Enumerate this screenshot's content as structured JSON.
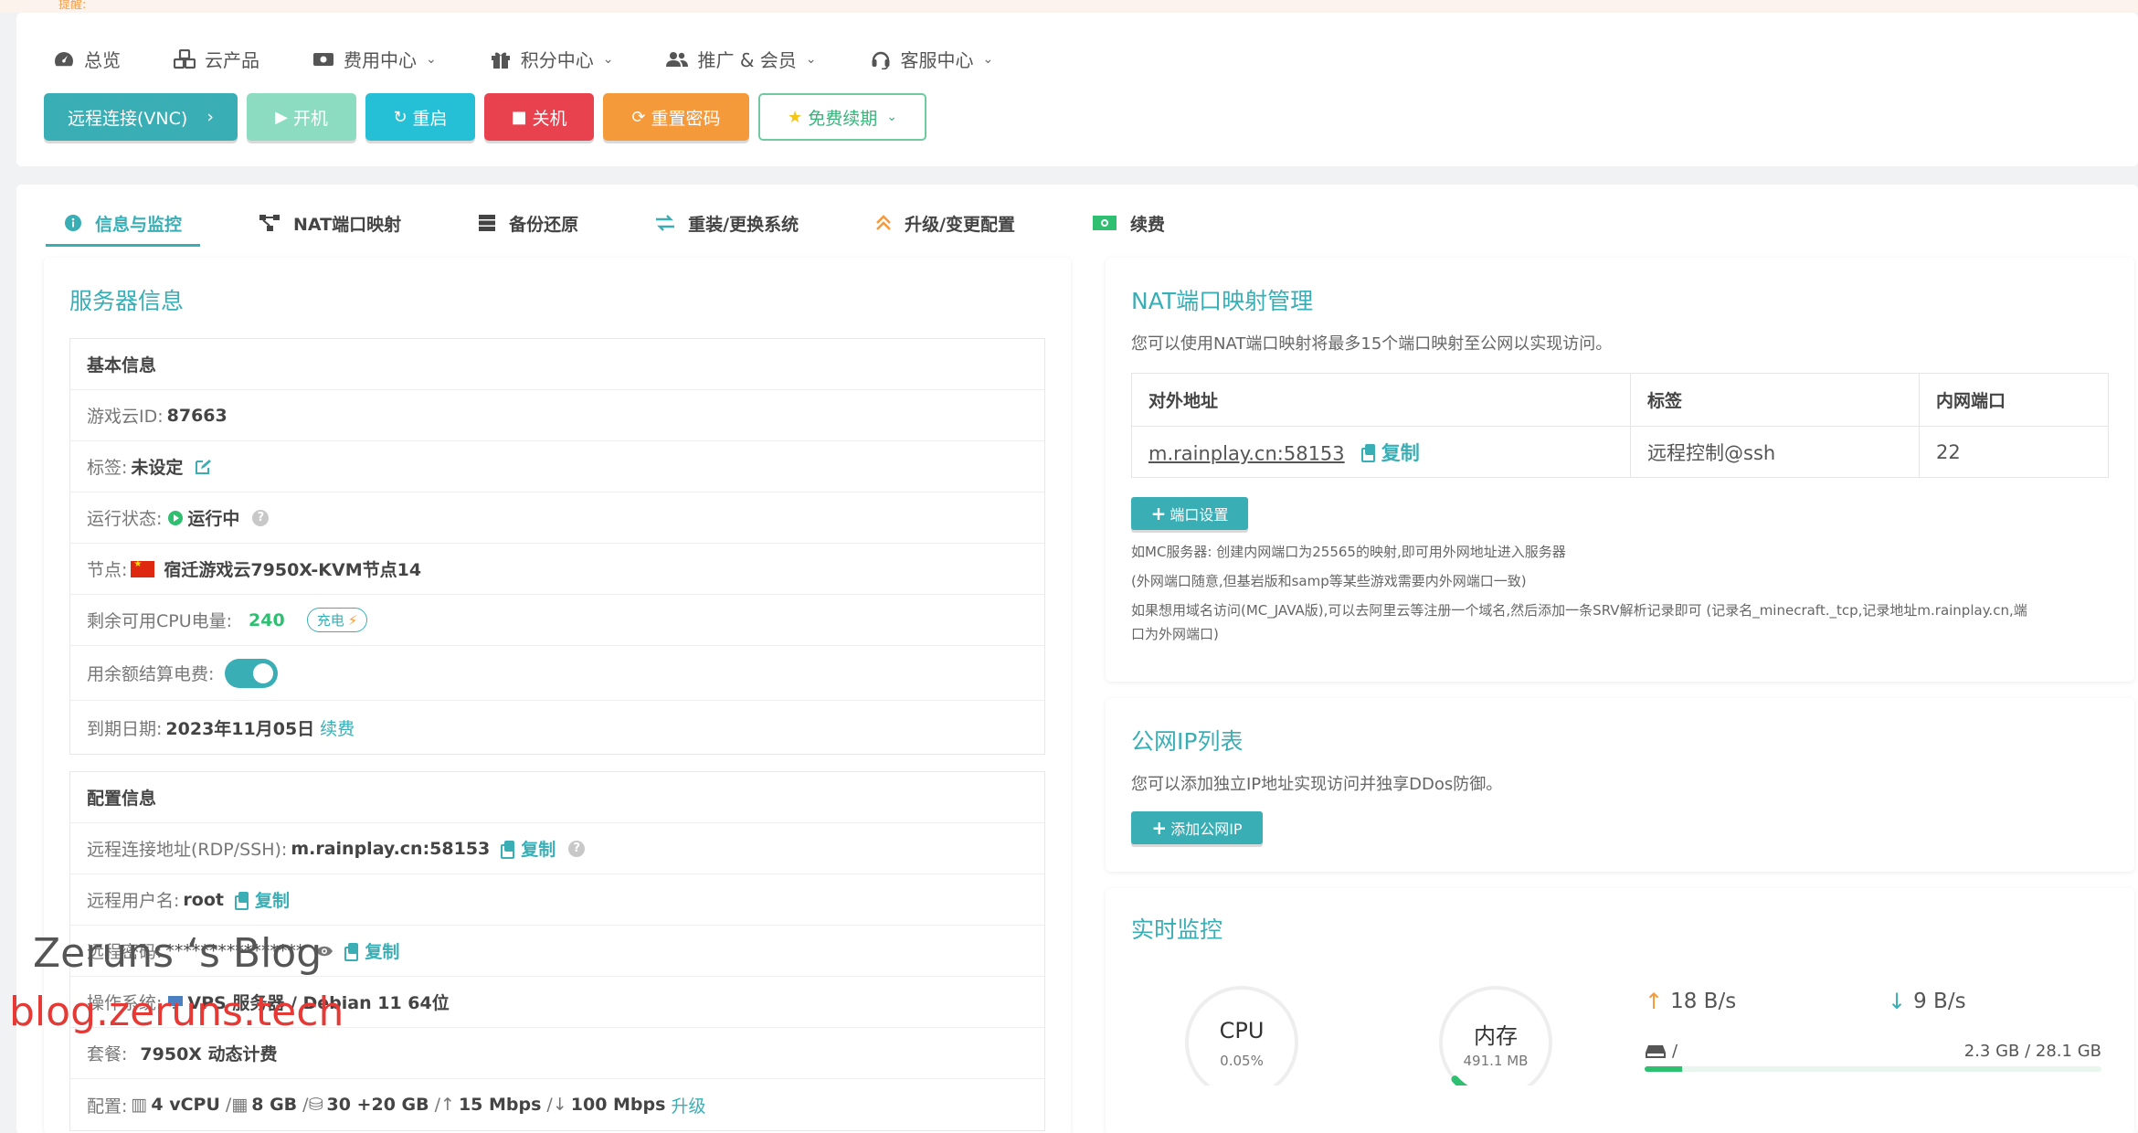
{
  "top_notice": "提醒:",
  "nav": [
    {
      "label": "总览",
      "icon": "dashboard-icon",
      "dropdown": false
    },
    {
      "label": "云产品",
      "icon": "cubes-icon",
      "dropdown": false
    },
    {
      "label": "费用中心",
      "icon": "money-icon",
      "dropdown": true
    },
    {
      "label": "积分中心",
      "icon": "gift-icon",
      "dropdown": true
    },
    {
      "label": "推广 & 会员",
      "icon": "users-icon",
      "dropdown": true
    },
    {
      "label": "客服中心",
      "icon": "headset-icon",
      "dropdown": true
    }
  ],
  "actions": {
    "vnc": "远程连接(VNC)",
    "power_on": "开机",
    "restart": "重启",
    "power_off": "关机",
    "reset_password": "重置密码",
    "free_renew": "免费续期"
  },
  "tabs": [
    {
      "label": "信息与监控",
      "active": true
    },
    {
      "label": "NAT端口映射"
    },
    {
      "label": "备份还原"
    },
    {
      "label": "重装/更换系统"
    },
    {
      "label": "升级/变更配置"
    },
    {
      "label": "续费"
    }
  ],
  "server": {
    "title": "服务器信息",
    "basic": {
      "header": "基本信息",
      "id_label": "游戏云ID:",
      "id_value": "87663",
      "tag_label": "标签:",
      "tag_value": "未设定",
      "status_label": "运行状态:",
      "status_value": "运行中",
      "node_label": "节点:",
      "node_value": "宿迁游戏云7950X-KVM节点14",
      "cpu_power_label": "剩余可用CPU电量:",
      "cpu_power_value": "240",
      "recharge": "充电",
      "balance_label": "用余额结算电费:",
      "balance_enabled": true,
      "expire_label": "到期日期:",
      "expire_value": "2023年11月05日",
      "renew_link": "续费"
    },
    "config": {
      "header": "配置信息",
      "remote_label": "远程连接地址(RDP/SSH):",
      "remote_value": "m.rainplay.cn:58153",
      "user_label": "远程用户名:",
      "user_value": "root",
      "pw_label": "远程密码:",
      "pw_value": "****************",
      "os_label": "操作系统:",
      "os_value": "VPS 服务器 / Debian 11 64位",
      "plan_label": "套餐:",
      "plan_value": "7950X 动态计费",
      "spec_label": "配置:",
      "spec_cpu": "4 vCPU",
      "spec_ram": "8 GB",
      "spec_disk": "30 +20 GB",
      "spec_up": "15 Mbps",
      "spec_down": "100 Mbps",
      "upgrade_link": "升级"
    },
    "copy_label": "复制"
  },
  "nat": {
    "title": "NAT端口映射管理",
    "desc": "您可以使用NAT端口映射将最多15个端口映射至公网以实现访问。",
    "columns": [
      "对外地址",
      "标签",
      "内网端口"
    ],
    "rows": [
      {
        "address": "m.rainplay.cn:58153",
        "tag": "远程控制@ssh",
        "port": "22"
      }
    ],
    "copy_label": "复制",
    "port_settings": "端口设置",
    "notes": [
      "如MC服务器: 创建内网端口为25565的映射,即可用外网地址进入服务器",
      "(外网端口随意,但基岩版和samp等某些游戏需要内外网端口一致)",
      "如果想用域名访问(MC_JAVA版),可以去阿里云等注册一个域名,然后添加一条SRV解析记录即可 (记录名_minecraft._tcp,记录地址m.rainplay.cn,端",
      "口为外网端口)"
    ]
  },
  "public_ip": {
    "title": "公网IP列表",
    "desc": "您可以添加独立IP地址实现访问并独享DDos防御。",
    "add_button": "添加公网IP"
  },
  "monitor": {
    "title": "实时监控",
    "cpu_label": "CPU",
    "cpu_value": "0.05%",
    "cpu_fraction": 0.0005,
    "mem_label": "内存",
    "mem_value": "491.1 MB",
    "mem_fraction": 0.06,
    "upload": "18 B/s",
    "download": "9 B/s",
    "disk_mount": "/",
    "disk_usage": "2.3 GB / 28.1 GB",
    "disk_fraction": 0.082
  },
  "watermark": {
    "line1": "Zeruns ‘s Blog",
    "line2": "blog.zeruns.tech"
  },
  "colors": {
    "accent": "#3aaeb5",
    "success": "#2fbf71",
    "danger": "#e8424f",
    "warning": "#f59a3b"
  }
}
